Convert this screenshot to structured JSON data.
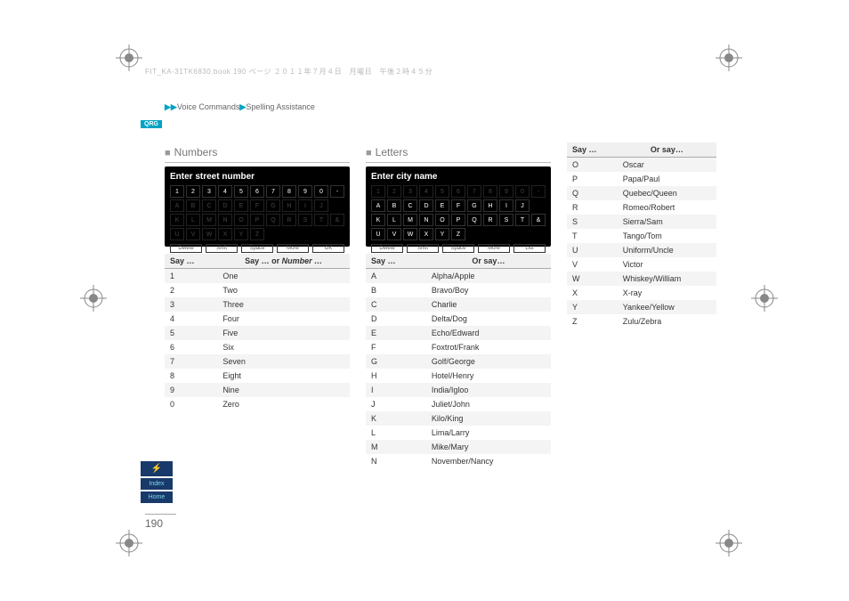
{
  "header_text": "FIT_KA-31TK6830.book  190 ページ  ２０１１年７月４日　月曜日　午後２時４５分",
  "breadcrumb": {
    "a": "Voice Commands",
    "b": "Spelling Assistance"
  },
  "qrg_label": "QRG",
  "page_number": "190",
  "side_tabs": {
    "index": "Index",
    "home": "Home"
  },
  "numbers": {
    "title": "Numbers",
    "screen_title": "Enter street number",
    "header_col1": "Say …",
    "header_col2_a": "Say … or ",
    "header_col2_b": "Number …",
    "rows": [
      {
        "k": "1",
        "v": "One"
      },
      {
        "k": "2",
        "v": "Two"
      },
      {
        "k": "3",
        "v": "Three"
      },
      {
        "k": "4",
        "v": "Four"
      },
      {
        "k": "5",
        "v": "Five"
      },
      {
        "k": "6",
        "v": "Six"
      },
      {
        "k": "7",
        "v": "Seven"
      },
      {
        "k": "8",
        "v": "Eight"
      },
      {
        "k": "9",
        "v": "Nine"
      },
      {
        "k": "0",
        "v": "Zero"
      }
    ],
    "bottom_buttons": [
      "Delete",
      "Shift",
      "Space",
      "More",
      "OK"
    ]
  },
  "letters": {
    "title": "Letters",
    "screen_title": "Enter city name",
    "header_col1": "Say …",
    "header_col2": "Or say…",
    "rows_left": [
      {
        "k": "A",
        "v": "Alpha/Apple"
      },
      {
        "k": "B",
        "v": "Bravo/Boy"
      },
      {
        "k": "C",
        "v": "Charlie"
      },
      {
        "k": "D",
        "v": "Delta/Dog"
      },
      {
        "k": "E",
        "v": "Echo/Edward"
      },
      {
        "k": "F",
        "v": "Foxtrot/Frank"
      },
      {
        "k": "G",
        "v": "Golf/George"
      },
      {
        "k": "H",
        "v": "Hotel/Henry"
      },
      {
        "k": "I",
        "v": "India/Igloo"
      },
      {
        "k": "J",
        "v": "Juliet/John"
      },
      {
        "k": "K",
        "v": "Kilo/King"
      },
      {
        "k": "L",
        "v": "Lima/Larry"
      },
      {
        "k": "M",
        "v": "Mike/Mary"
      },
      {
        "k": "N",
        "v": "November/Nancy"
      }
    ],
    "rows_right": [
      {
        "k": "O",
        "v": "Oscar"
      },
      {
        "k": "P",
        "v": "Papa/Paul"
      },
      {
        "k": "Q",
        "v": "Quebec/Queen"
      },
      {
        "k": "R",
        "v": "Romeo/Robert"
      },
      {
        "k": "S",
        "v": "Sierra/Sam"
      },
      {
        "k": "T",
        "v": "Tango/Tom"
      },
      {
        "k": "U",
        "v": "Uniform/Uncle"
      },
      {
        "k": "V",
        "v": "Victor"
      },
      {
        "k": "W",
        "v": "Whiskey/William"
      },
      {
        "k": "X",
        "v": "X-ray"
      },
      {
        "k": "Y",
        "v": "Yankee/Yellow"
      },
      {
        "k": "Z",
        "v": "Zulu/Zebra"
      }
    ],
    "bottom_buttons": [
      "Delete",
      "Shift",
      "Space",
      "More",
      "List"
    ]
  }
}
